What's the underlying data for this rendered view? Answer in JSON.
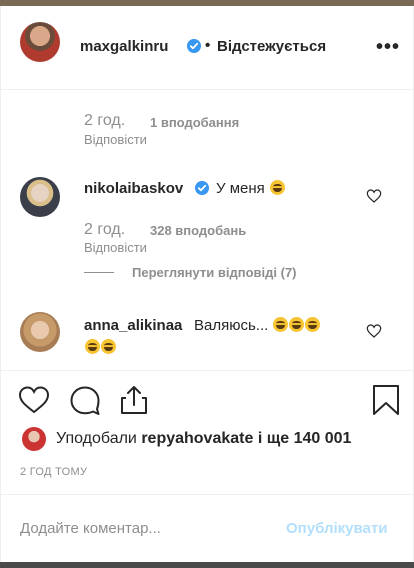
{
  "header": {
    "username": "maxgalkinru",
    "separator": "•",
    "follow_status": "Відстежується",
    "more_icon": "more-horizontal-icon"
  },
  "comments": [
    {
      "time": "2 год.",
      "likes": "1 вподобання",
      "reply": "Відповісти"
    },
    {
      "username": "nikolaibaskov",
      "verified": true,
      "text": "У меня",
      "emoji_count": 1,
      "time": "2 год.",
      "likes": "328 вподобань",
      "reply": "Відповісти",
      "view_replies": "Переглянути відповіді (7)"
    },
    {
      "username": "anna_alikinaa",
      "text": "Валяюсь...",
      "emoji_count": 5,
      "emoji": "rolling-laughing"
    }
  ],
  "actions": {
    "like_icon": "heart-icon",
    "comment_icon": "comment-icon",
    "share_icon": "share-icon",
    "save_icon": "bookmark-icon"
  },
  "likes": {
    "prefix": "Уподобали",
    "user": "repyahovakate",
    "suffix": "і ще 140 001"
  },
  "timestamp": "2 ГОД ТОМУ",
  "comment_box": {
    "placeholder": "Додайте коментар...",
    "publish_label": "Опублікувати"
  },
  "colors": {
    "verified": "#3897f0",
    "meta": "#8e8e8e",
    "publish_disabled": "#b2dffc",
    "text": "#262626"
  }
}
